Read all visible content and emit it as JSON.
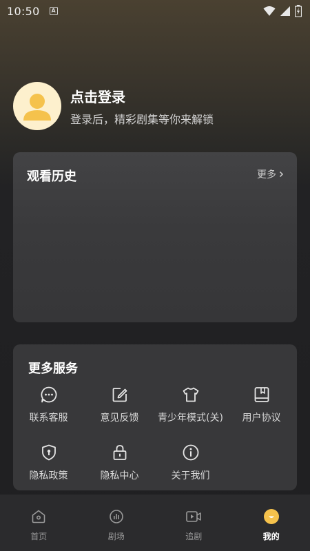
{
  "status_bar": {
    "time": "10:50",
    "a_label": "A"
  },
  "profile": {
    "title": "点击登录",
    "subtitle": "登录后，精彩剧集等你来解锁",
    "avatar_color": "#f5c24c"
  },
  "history": {
    "title": "观看历史",
    "more": "更多"
  },
  "services": {
    "title": "更多服务",
    "items": [
      {
        "label": "联系客服",
        "icon": "chat-icon"
      },
      {
        "label": "意见反馈",
        "icon": "edit-icon"
      },
      {
        "label": "青少年模式(关)",
        "icon": "tshirt-icon"
      },
      {
        "label": "用户协议",
        "icon": "book-icon"
      },
      {
        "label": "隐私政策",
        "icon": "shield-icon"
      },
      {
        "label": "隐私中心",
        "icon": "lock-icon"
      },
      {
        "label": "关于我们",
        "icon": "info-icon"
      }
    ]
  },
  "tabbar": {
    "items": [
      {
        "label": "首页",
        "icon": "home-icon"
      },
      {
        "label": "剧场",
        "icon": "theater-icon"
      },
      {
        "label": "追剧",
        "icon": "video-icon"
      },
      {
        "label": "我的",
        "icon": "mine-icon",
        "active": true
      }
    ],
    "active_color": "#f5c24c"
  }
}
